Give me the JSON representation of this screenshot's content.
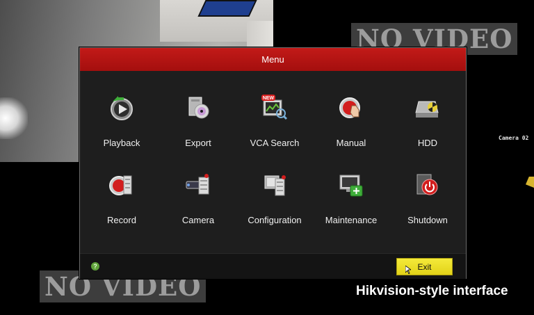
{
  "background": {
    "no_video_label": "NO VIDEO",
    "camera_label": "Camera 02"
  },
  "menu": {
    "title": "Menu",
    "items": [
      {
        "label": "Playback",
        "icon": "playback-icon"
      },
      {
        "label": "Export",
        "icon": "export-icon"
      },
      {
        "label": "VCA Search",
        "icon": "vca-search-icon",
        "badge": "NEW"
      },
      {
        "label": "Manual",
        "icon": "manual-record-icon"
      },
      {
        "label": "HDD",
        "icon": "hdd-icon"
      },
      {
        "label": "Record",
        "icon": "record-icon"
      },
      {
        "label": "Camera",
        "icon": "camera-icon"
      },
      {
        "label": "Configuration",
        "icon": "configuration-icon"
      },
      {
        "label": "Maintenance",
        "icon": "maintenance-icon"
      },
      {
        "label": "Shutdown",
        "icon": "shutdown-icon"
      }
    ],
    "help_glyph": "?",
    "exit_label": "Exit"
  },
  "caption": "Hikvision-style interface",
  "colors": {
    "header_red": "#b3130f",
    "exit_yellow": "#ece021",
    "dialog_bg": "#1e1e1e"
  }
}
